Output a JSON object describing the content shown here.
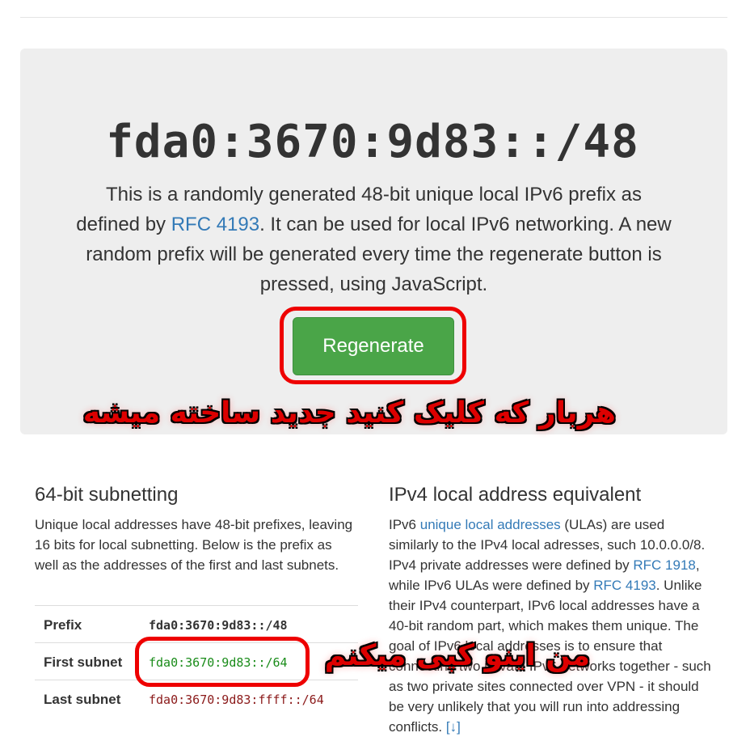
{
  "hero": {
    "prefix": "fda0:3670:9d83::/48",
    "lead_part1": "This is a randomly generated 48-bit unique local IPv6 prefix as defined by ",
    "lead_link": "RFC 4193",
    "lead_part2": ". It can be used for local IPv6 networking. A new random prefix will be generated every time the regenerate button is pressed, using JavaScript.",
    "button_label": "Regenerate"
  },
  "annotations": {
    "button_note": "هربار که کلیک کنید جدید ساخته میشه",
    "copy_note": "من اینو کپی میکنم"
  },
  "subnetting": {
    "heading": "64-bit subnetting",
    "text": "Unique local addresses have 48-bit prefixes, leaving 16 bits for local subnetting. Below is the prefix as well as the addresses of the first and last subnets.",
    "rows": [
      {
        "label": "Prefix",
        "value": "fda0:3670:9d83::/48"
      },
      {
        "label": "First subnet",
        "value": "fda0:3670:9d83::/64"
      },
      {
        "label": "Last subnet",
        "value": "fda0:3670:9d83:ffff::/64"
      }
    ]
  },
  "ipv4": {
    "heading": "IPv4 local address equivalent",
    "t1": "IPv6 ",
    "l1": "unique local addresses",
    "t2": " (ULAs) are used similarly to the IPv4 local adresses, such 10.0.0.0/8. IPv4 private addresses were defined by ",
    "l2": "RFC 1918",
    "t3": ", while IPv6 ULAs were defined by ",
    "l3": "RFC 4193",
    "t4": ". Unlike their IPv4 counterpart, IPv6 local addresses have a 40-bit random part, which makes them unique. The goal of IPv6 local addresses is to ensure that connecting two private IPv6 networks together - such as two private sites connected over VPN - it should be very unlikely that you will run into addressing conflicts. ",
    "l4": "[↓]"
  },
  "colors": {
    "jumbotron_bg": "#eeeeee",
    "button_green": "#4aa548",
    "link_blue": "#337ab7",
    "annotation_red": "#ee0000",
    "first_subnet_green": "#1a8c1a",
    "last_subnet_red": "#8b1a1a"
  }
}
